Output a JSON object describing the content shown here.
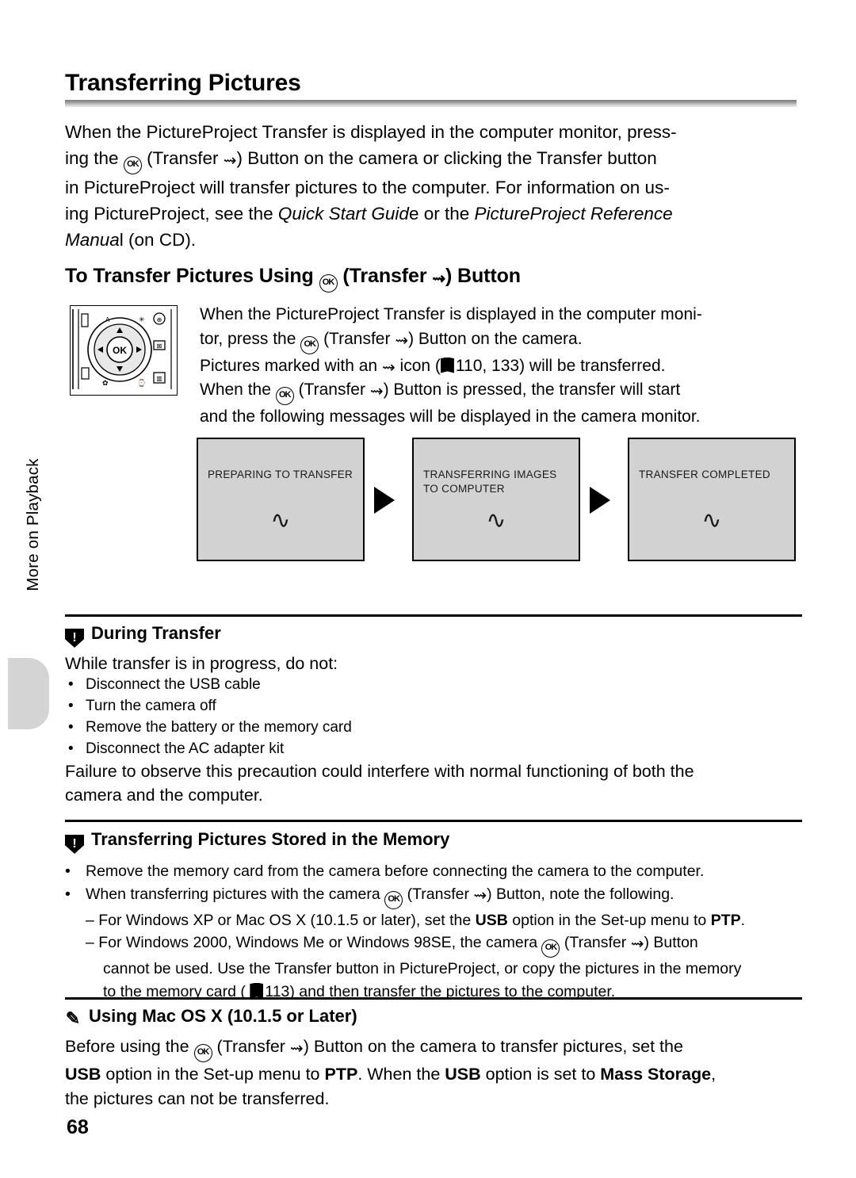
{
  "page": {
    "number": "68",
    "side_label": "More on Playback",
    "title": "Transferring Pictures"
  },
  "intro": {
    "lines": [
      "When the PictureProject Transfer is displayed in the computer monitor, press-",
      "ing the [OK] (Transfer [~]) Button on the camera or clicking the Transfer button",
      "in PictureProject will transfer pictures to the computer. For information on us-",
      "ing PictureProject, see the Quick Start Guide or the PictureProject Reference",
      "Manual (on CD)."
    ],
    "line1": "When the PictureProject Transfer is displayed in the computer monitor, press-",
    "line3": "in PictureProject will transfer pictures to the computer. For information on us-",
    "line5_tail": " (on CD)."
  },
  "subheading": {
    "prefix": "To Transfer Pictures Using ",
    "mid": " (Transfer ",
    "suffix": ") Button"
  },
  "body": {
    "l1": "When the PictureProject Transfer is displayed in the computer moni-",
    "l2a": "tor, press the ",
    "l2b": " (Transfer ",
    "l2c": ") Button on the camera.",
    "l3a": "Pictures marked with an ",
    "l3b": " icon (",
    "l3c": "110, 133) will be transferred.",
    "l4a": "When the ",
    "l4b": " (Transfer ",
    "l4c": ") Button is pressed, the transfer will start",
    "l5": "and the following messages will be displayed in the camera monitor."
  },
  "screens": [
    {
      "name": "preparing",
      "text": "PREPARING TO TRANSFER",
      "icon": "transfer-wave-icon"
    },
    {
      "name": "transferring",
      "text": "TRANSFERRING IMAGES TO COMPUTER",
      "icon": "transfer-wave-icon"
    },
    {
      "name": "completed",
      "text": "TRANSFER COMPLETED",
      "icon": "transfer-wave-icon"
    }
  ],
  "note_during_transfer": {
    "heading": "During Transfer",
    "intro": "While transfer is in progress, do not:",
    "bullets": [
      "Disconnect the USB cable",
      "Turn the camera off",
      "Remove the battery or the memory card",
      "Disconnect the AC adapter kit"
    ],
    "closing_l1": "Failure to observe this precaution could interfere with normal functioning of both the",
    "closing_l2": "camera and the computer."
  },
  "note_memory": {
    "heading": "Transferring Pictures Stored in the Memory",
    "b1": "Remove the memory card from the camera before connecting the camera to the computer.",
    "b2a": "When transferring pictures with the camera ",
    "b2b": " (Transfer ",
    "b2c": ") Button, note the following.",
    "d1a": "– For Windows XP or Mac OS X (10.1.5 or later), set the ",
    "d1b": "USB",
    "d1c": " option in the Set-up menu to ",
    "d1d": "PTP",
    "d1e": ".",
    "d2a": "– For Windows 2000, Windows Me or Windows 98SE, the camera ",
    "d2b": " (Transfer ",
    "d2c": ") Button",
    "d3": "cannot be used. Use the Transfer button in PictureProject, or copy the pictures in the memory",
    "d4a": "to the memory card (",
    "d4b": "113) and then transfer the pictures to the computer."
  },
  "note_macos": {
    "heading": "Using Mac OS X (10.1.5 or Later)",
    "l1a": "Before using the ",
    "l1b": " (Transfer ",
    "l1c": ") Button on the camera to transfer pictures, set the",
    "l2a": "USB",
    "l2b": " option in the Set-up menu to ",
    "l2c": "PTP",
    "l2d": ". When the ",
    "l2e": "USB",
    "l2f": " option is set to ",
    "l2g": "Mass Storage",
    "l2h": ",",
    "l3": "the pictures can not be transferred."
  },
  "icons": {
    "ok": "OK",
    "transfer": "⌁",
    "wave": "∿",
    "book": "book-icon",
    "warning": "warning-triangle-icon",
    "pencil": "✎"
  },
  "colors": {
    "screen_fill": "#d2d2d2",
    "tab_fill": "#d4d4d4",
    "rule": "#000000"
  }
}
